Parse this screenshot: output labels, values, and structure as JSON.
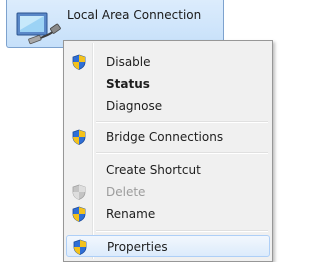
{
  "connection": {
    "label": "Local Area Connection",
    "icon": "network-adapter-icon"
  },
  "menu": {
    "items": [
      {
        "label": "Disable",
        "icon": "uac-shield-icon",
        "bold": false,
        "disabled": false
      },
      {
        "label": "Status",
        "icon": null,
        "bold": true,
        "disabled": false
      },
      {
        "label": "Diagnose",
        "icon": null,
        "bold": false,
        "disabled": false
      },
      {
        "label": "Bridge Connections",
        "icon": "uac-shield-icon",
        "bold": false,
        "disabled": false
      },
      {
        "label": "Create Shortcut",
        "icon": null,
        "bold": false,
        "disabled": false
      },
      {
        "label": "Delete",
        "icon": "uac-shield-icon",
        "bold": false,
        "disabled": true
      },
      {
        "label": "Rename",
        "icon": "uac-shield-icon",
        "bold": false,
        "disabled": false
      },
      {
        "label": "Properties",
        "icon": "uac-shield-icon",
        "bold": false,
        "disabled": false,
        "highlighted": true
      }
    ]
  },
  "colors": {
    "shield_blue": "#2f6fd6",
    "shield_yellow": "#f4c21c",
    "highlight": "#dcebfc"
  }
}
